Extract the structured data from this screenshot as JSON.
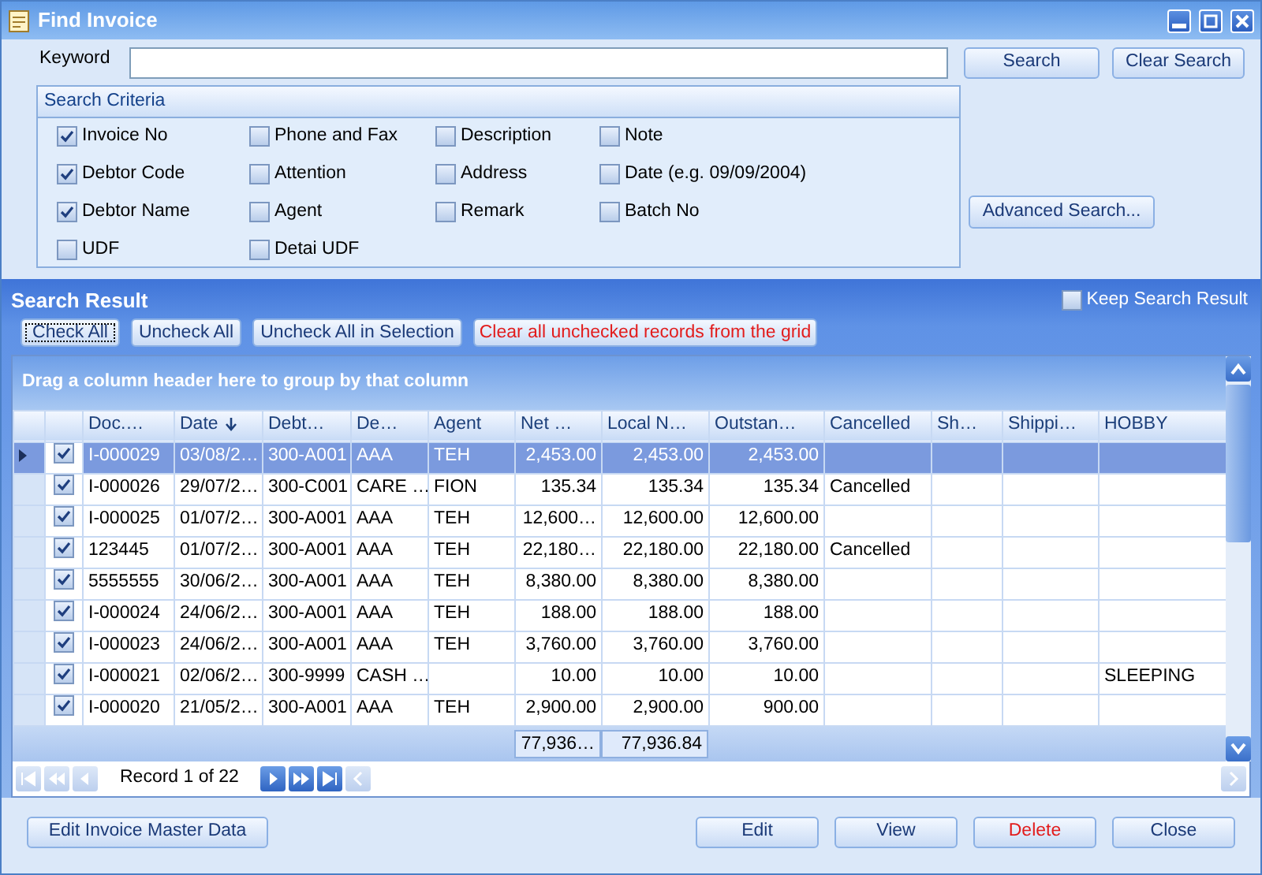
{
  "window": {
    "title": "Find Invoice"
  },
  "keyword": {
    "label": "Keyword"
  },
  "top_buttons": [
    {
      "label": "Search"
    },
    {
      "label": "Clear Search"
    }
  ],
  "search_criteria": {
    "title": "Search Criteria",
    "options": [
      {
        "label": "Invoice No",
        "checked": true
      },
      {
        "label": "Phone and Fax",
        "checked": false
      },
      {
        "label": "Description",
        "checked": false
      },
      {
        "label": "Note",
        "checked": false
      },
      {
        "label": "Debtor Code",
        "checked": true
      },
      {
        "label": "Attention",
        "checked": false
      },
      {
        "label": "Address",
        "checked": false
      },
      {
        "label": "Date (e.g. 09/09/2004)",
        "checked": false
      },
      {
        "label": "Debtor Name",
        "checked": true
      },
      {
        "label": "Agent",
        "checked": false
      },
      {
        "label": "Remark",
        "checked": false
      },
      {
        "label": "Batch No",
        "checked": false
      },
      {
        "label": "UDF",
        "checked": false
      },
      {
        "label": "Detai UDF",
        "checked": false
      }
    ]
  },
  "advanced_search": {
    "label": "Advanced Search..."
  },
  "search_result": {
    "title": "Search Result",
    "keep_search_result": {
      "label": "Keep Search Result",
      "checked": false
    },
    "buttons": [
      {
        "label": "Check All",
        "kind": "focused"
      },
      {
        "label": "Uncheck All",
        "kind": "normal"
      },
      {
        "label": "Uncheck All in Selection",
        "kind": "normal"
      },
      {
        "label": "Clear all unchecked records from the grid",
        "kind": "danger"
      }
    ]
  },
  "grid": {
    "group_hint": "Drag a column header here to group by that column",
    "columns": [
      {
        "label": "Doc.…",
        "kind": "text",
        "sorted_descending": false
      },
      {
        "label": "Date",
        "kind": "text",
        "sorted_descending": true
      },
      {
        "label": "Debt…",
        "kind": "text",
        "sorted_descending": false
      },
      {
        "label": "De…",
        "kind": "text",
        "sorted_descending": false
      },
      {
        "label": "Agent",
        "kind": "text",
        "sorted_descending": false
      },
      {
        "label": "Net …",
        "kind": "number",
        "sorted_descending": false
      },
      {
        "label": "Local N…",
        "kind": "number",
        "sorted_descending": false
      },
      {
        "label": "Outstan…",
        "kind": "number",
        "sorted_descending": false
      },
      {
        "label": "Cancelled",
        "kind": "text",
        "sorted_descending": false
      },
      {
        "label": "Sh…",
        "kind": "text",
        "sorted_descending": false
      },
      {
        "label": "Shippi…",
        "kind": "text",
        "sorted_descending": false
      },
      {
        "label": "HOBBY",
        "kind": "text",
        "sorted_descending": false
      }
    ],
    "rows": [
      {
        "selected": true,
        "checked": true,
        "cells": [
          "I-000029",
          "03/08/2…",
          "300-A001",
          "AAA",
          "TEH",
          "2,453.00",
          "2,453.00",
          "2,453.00",
          "",
          "",
          "",
          ""
        ]
      },
      {
        "selected": false,
        "checked": true,
        "cells": [
          "I-000026",
          "29/07/2…",
          "300-C001",
          "CARE …",
          "FION",
          "135.34",
          "135.34",
          "135.34",
          "Cancelled",
          "",
          "",
          ""
        ]
      },
      {
        "selected": false,
        "checked": true,
        "cells": [
          "I-000025",
          "01/07/2…",
          "300-A001",
          "AAA",
          "TEH",
          "12,600…",
          "12,600.00",
          "12,600.00",
          "",
          "",
          "",
          ""
        ]
      },
      {
        "selected": false,
        "checked": true,
        "cells": [
          "123445",
          "01/07/2…",
          "300-A001",
          "AAA",
          "TEH",
          "22,180…",
          "22,180.00",
          "22,180.00",
          "Cancelled",
          "",
          "",
          ""
        ]
      },
      {
        "selected": false,
        "checked": true,
        "cells": [
          "5555555",
          "30/06/2…",
          "300-A001",
          "AAA",
          "TEH",
          "8,380.00",
          "8,380.00",
          "8,380.00",
          "",
          "",
          "",
          ""
        ]
      },
      {
        "selected": false,
        "checked": true,
        "cells": [
          "I-000024",
          "24/06/2…",
          "300-A001",
          "AAA",
          "TEH",
          "188.00",
          "188.00",
          "188.00",
          "",
          "",
          "",
          ""
        ]
      },
      {
        "selected": false,
        "checked": true,
        "cells": [
          "I-000023",
          "24/06/2…",
          "300-A001",
          "AAA",
          "TEH",
          "3,760.00",
          "3,760.00",
          "3,760.00",
          "",
          "",
          "",
          ""
        ]
      },
      {
        "selected": false,
        "checked": true,
        "cells": [
          "I-000021",
          "02/06/2…",
          "300-9999",
          "CASH …",
          "",
          "10.00",
          "10.00",
          "10.00",
          "",
          "",
          "",
          "SLEEPING"
        ]
      },
      {
        "selected": false,
        "checked": true,
        "cells": [
          "I-000020",
          "21/05/2…",
          "300-A001",
          "AAA",
          "TEH",
          "2,900.00",
          "2,900.00",
          "900.00",
          "",
          "",
          "",
          ""
        ]
      }
    ],
    "totals": [
      "77,936…",
      "77,936.84"
    ]
  },
  "navigator": {
    "record_text": "Record 1 of 22",
    "buttons": [
      {
        "kind": "first",
        "disabled": true
      },
      {
        "kind": "prev-page",
        "disabled": true
      },
      {
        "kind": "prev",
        "disabled": true
      },
      {
        "kind": "next",
        "disabled": false
      },
      {
        "kind": "next-page",
        "disabled": false
      },
      {
        "kind": "last",
        "disabled": false
      }
    ]
  },
  "bottom_buttons": [
    {
      "label": "Edit Invoice Master Data",
      "kind": "normal"
    },
    {
      "label": "Edit",
      "kind": "normal"
    },
    {
      "label": "View",
      "kind": "normal"
    },
    {
      "label": "Delete",
      "kind": "danger"
    },
    {
      "label": "Close",
      "kind": "normal"
    }
  ]
}
